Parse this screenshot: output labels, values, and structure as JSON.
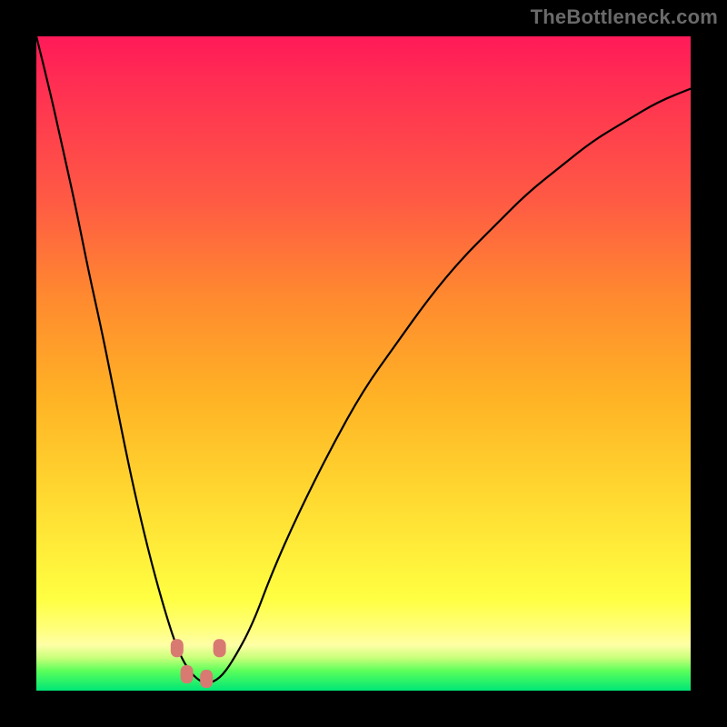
{
  "watermark": "TheBottleneck.com",
  "colors": {
    "frame": "#000000",
    "gradient_top": "#ff1a58",
    "gradient_bottom": "#00e676",
    "curve": "#000000",
    "marker": "#d97a72"
  },
  "chart_data": {
    "type": "line",
    "title": "",
    "xlabel": "",
    "ylabel": "",
    "xlim": [
      0,
      100
    ],
    "ylim": [
      0,
      100
    ],
    "series": [
      {
        "name": "curve",
        "x": [
          0,
          2,
          4,
          6,
          8,
          10,
          12,
          14,
          16,
          18,
          20,
          21.5,
          23,
          24.5,
          26,
          28,
          30,
          33,
          36,
          40,
          45,
          50,
          55,
          60,
          65,
          70,
          75,
          80,
          85,
          90,
          95,
          100
        ],
        "values": [
          100,
          92,
          83,
          74,
          64,
          55,
          45,
          35,
          26,
          18,
          11,
          6.5,
          3.5,
          1.8,
          1.0,
          1.8,
          4.5,
          10,
          18,
          27,
          37,
          46,
          53,
          60,
          66,
          71,
          76,
          80,
          84,
          87,
          90,
          92
        ]
      }
    ],
    "markers": [
      {
        "name": "left-upper",
        "x": 21.5,
        "y": 6.5
      },
      {
        "name": "left-lower",
        "x": 23.0,
        "y": 2.5
      },
      {
        "name": "right-lower",
        "x": 26.0,
        "y": 1.8
      },
      {
        "name": "right-upper",
        "x": 28.0,
        "y": 6.5
      }
    ],
    "annotations": []
  }
}
